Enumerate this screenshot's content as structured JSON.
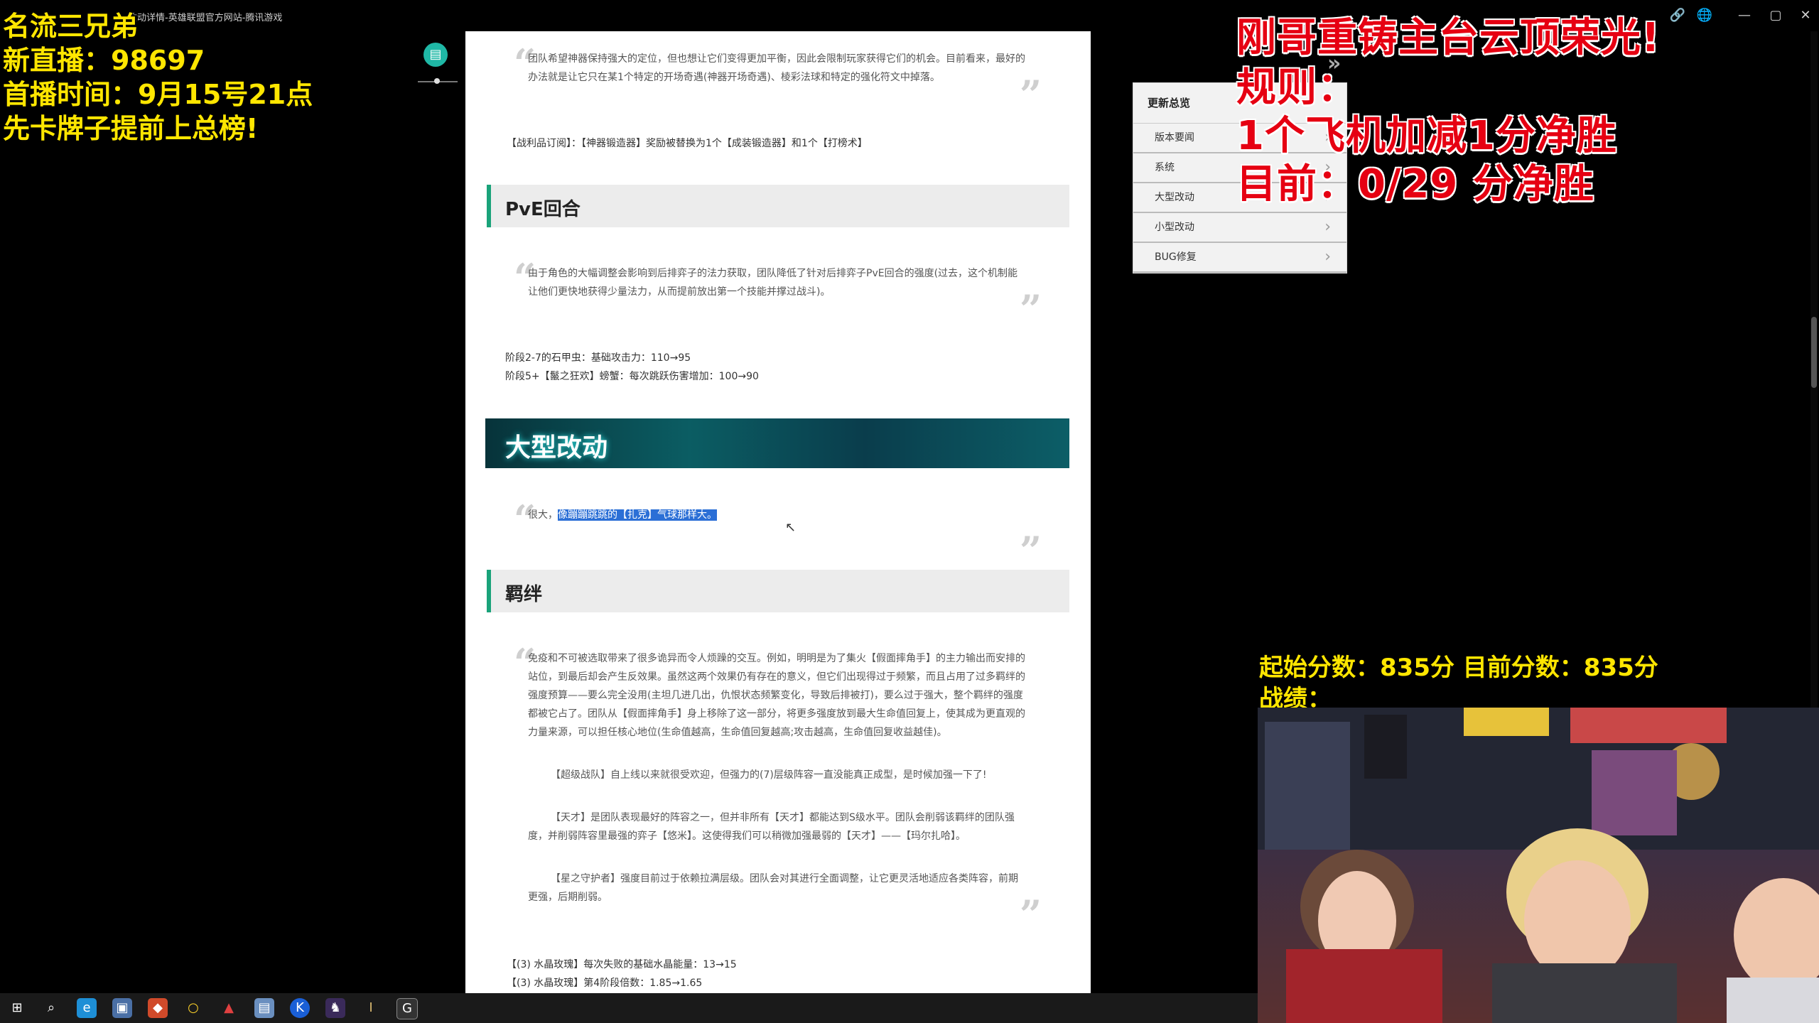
{
  "browser": {
    "title": "改动详情-英雄联盟官方网站-腾讯游戏",
    "controls": [
      "🔗",
      "🌐",
      "—",
      "▢",
      "✕"
    ]
  },
  "overlays": {
    "left_lines": [
      "名流三兄弟",
      "新直播：98697",
      "首播时间：9月15号21点",
      "先卡牌子提前上总榜!"
    ],
    "right_lines": [
      "刚哥重铸主台云顶荣光!",
      "规则：",
      "1个飞机加减1分净胜",
      "目前：0/29 分净胜"
    ],
    "score_line": "起始分数：835分 目前分数：835分",
    "record_line": "战绩："
  },
  "article": {
    "quote1": "团队希望神器保持强大的定位，但也想让它们变得更加平衡，因此会限制玩家获得它们的机会。目前看来，最好的办法就是让它只在某1个特定的开场奇遇(神器开场奇遇)、棱彩法球和特定的强化符文中掉落。",
    "line1": "【战利品订阅】：【神器锻造器】奖励被替换为1个【成装锻造器】和1个【打榜术】",
    "pve_heading": "PvE回合",
    "quote2": "由于角色的大幅调整会影响到后排弈子的法力获取，团队降低了针对后排弈子PvE回合的强度(过去，这个机制能让他们更快地获得少量法力，从而提前放出第一个技能并撑过战斗)。",
    "pve_lines": [
      "阶段2-7的石甲虫：基础攻击力：110→95",
      "阶段5+【鬣之狂欢】螃蟹：每次跳跃伤害增加：100→90"
    ],
    "big_change_heading": "大型改动",
    "quote3_plain": "很大，",
    "quote3_highlight": "像蹦蹦跳跳的【扎克】气球那样大。",
    "traits_heading": "羁绊",
    "quote4_paragraphs": [
      "免疫和不可被选取带来了很多诡异而令人烦躁的交互。例如，明明是为了集火【假面摔角手】的主力输出而安排的站位，到最后却会产生反效果。虽然这两个效果仍有存在的意义，但它们出现得过于频繁，而且占用了过多羁绊的强度预算——要么完全没用(主坦几进几出，仇恨状态频繁变化，导致后排被打)，要么过于强大，整个羁绊的强度都被它占了。团队从【假面摔角手】身上移除了这一部分，将更多强度放到最大生命值回复上，使其成为更直观的力量来源，可以担任核心地位(生命值越高，生命值回复越高;攻击越高，生命值回复收益越佳)。",
      "【超级战队】自上线以来就很受欢迎，但强力的(7)层级阵容一直没能真正成型，是时候加强一下了!",
      "【天才】是团队表现最好的阵容之一，但并非所有【天才】都能达到S级水平。团队会削弱该羁绊的团队强度，并削弱阵容里最强的弈子【悠米】。这使得我们可以稍微加强最弱的【天才】——【玛尔扎哈】。",
      "【星之守护者】强度目前过于依赖拉满层级。团队会对其进行全面调整，让它更灵活地适应各类阵容，前期更强，后期削弱。"
    ],
    "final_lines": [
      "【(3) 水晶玫瑰】每次失败的基础水晶能量：13→15",
      "【(3) 水晶玫瑰】第4阶段倍数：1.85→1.65"
    ]
  },
  "nav": {
    "header": "更新总览",
    "items": [
      "版本要闻",
      "系统",
      "大型改动",
      "小型改动",
      "BUG修复"
    ]
  },
  "taskbar": {
    "icons": [
      "windows-start-icon",
      "search-icon",
      "edge-browser-icon",
      "file-manager-icon",
      "app-red-icon",
      "app-circle-icon",
      "app-wing-icon",
      "app-blue-icon",
      "k-app-icon",
      "game-icon",
      "bow-icon",
      "g-app-icon"
    ]
  }
}
